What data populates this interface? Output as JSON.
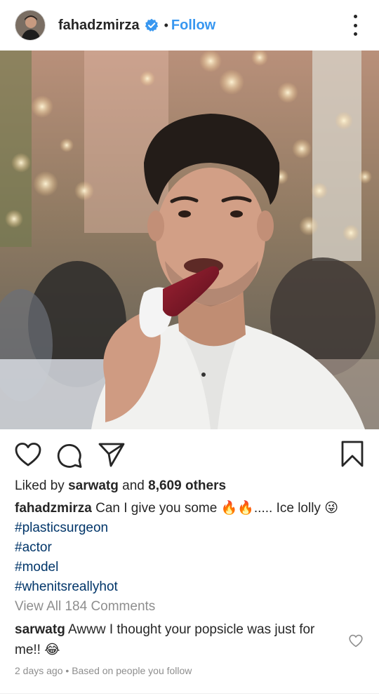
{
  "header": {
    "username": "fahadzmirza",
    "separator": "•",
    "follow_label": "Follow",
    "icons": [
      "avatar",
      "verified-badge-icon",
      "more-options-icon"
    ]
  },
  "post": {
    "photo_alt": "",
    "action_icons": [
      "heart-icon",
      "comment-icon",
      "share-icon",
      "bookmark-icon"
    ]
  },
  "likes": {
    "prefix": "Liked by",
    "user": "sarwatg",
    "connector": "and",
    "others": "8,609 others"
  },
  "caption": {
    "user": "fahadzmirza",
    "text_before": "Can I give you some",
    "emoji_fire": "🔥🔥",
    "text_after": "..... Ice lolly",
    "emoji_face": "😜",
    "hashtags": [
      "#plasticsurgeon",
      "#actor",
      "#model",
      "#whenitsreallyhot"
    ]
  },
  "view_all": "View All 184 Comments",
  "comment": {
    "user": "sarwatg",
    "text": "Awww I thought your popsicle was just for me!!",
    "emoji": "😂"
  },
  "meta": {
    "time": "2 days ago",
    "separator": "•",
    "reason": "Based on people you follow"
  },
  "colors": {
    "link_blue": "#3897f0",
    "hashtag_blue": "#003569",
    "muted_gray": "#8e8e8e",
    "text_dark": "#262626"
  }
}
